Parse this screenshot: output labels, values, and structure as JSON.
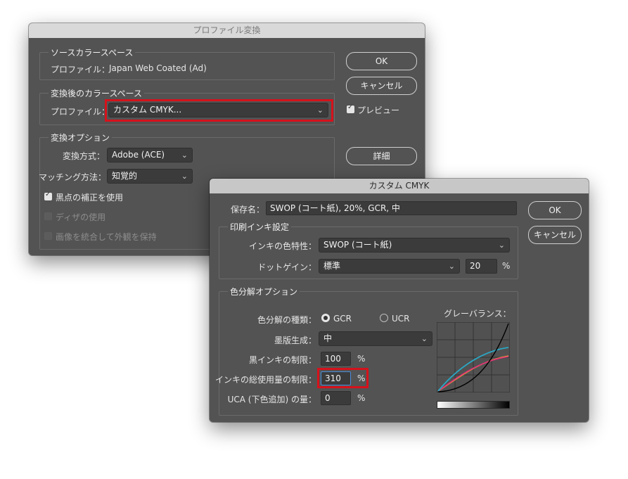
{
  "dialog1": {
    "title": "プロファイル変換",
    "source": {
      "legend": "ソースカラースペース",
      "profile_label": "プロファイル：",
      "profile_value": "Japan Web Coated (Ad)"
    },
    "dest": {
      "legend": "変換後のカラースペース",
      "profile_label": "プロファイル：",
      "profile_value": "カスタム CMYK..."
    },
    "options": {
      "legend": "変換オプション",
      "engine_label": "変換方式：",
      "engine_value": "Adobe (ACE)",
      "intent_label": "マッチング方法：",
      "intent_value": "知覚的",
      "bpc_label": "黒点の補正を使用",
      "dither_label": "ディザの使用",
      "flatten_label": "画像を統合して外観を保持"
    },
    "buttons": {
      "ok": "OK",
      "cancel": "キャンセル",
      "preview": "プレビュー",
      "advanced": "詳細"
    }
  },
  "dialog2": {
    "title": "カスタム CMYK",
    "name_label": "保存名：",
    "name_value": "SWOP (コート紙), 20%, GCR, 中",
    "ink": {
      "legend": "印刷インキ設定",
      "colors_label": "インキの色特性：",
      "colors_value": "SWOP (コート紙)",
      "dotgain_label": "ドットゲイン：",
      "dotgain_value": "標準",
      "dotgain_pct": "20",
      "pct": "%"
    },
    "sep": {
      "legend": "色分解オプション",
      "type_label": "色分解の種類：",
      "gcr": "GCR",
      "ucr": "UCR",
      "black_gen_label": "墨版生成：",
      "black_gen_value": "中",
      "black_limit_label": "黒インキの制限：",
      "black_limit_value": "100",
      "total_limit_label": "インキの総使用量の制限：",
      "total_limit_value": "310",
      "uca_label": "UCA (下色追加) の量：",
      "uca_value": "0",
      "pct": "%",
      "gray_balance_label": "グレーバランス："
    },
    "buttons": {
      "ok": "OK",
      "cancel": "キャンセル"
    }
  },
  "colors": {
    "highlight": "#d5121c",
    "dialog_bg": "#535353",
    "field_bg": "#3b3b3b",
    "curve_black": "#000000",
    "curve_cyan": "#2aa7c4",
    "curve_magenta": "#e0307a",
    "curve_yellow": "#e8a030"
  }
}
